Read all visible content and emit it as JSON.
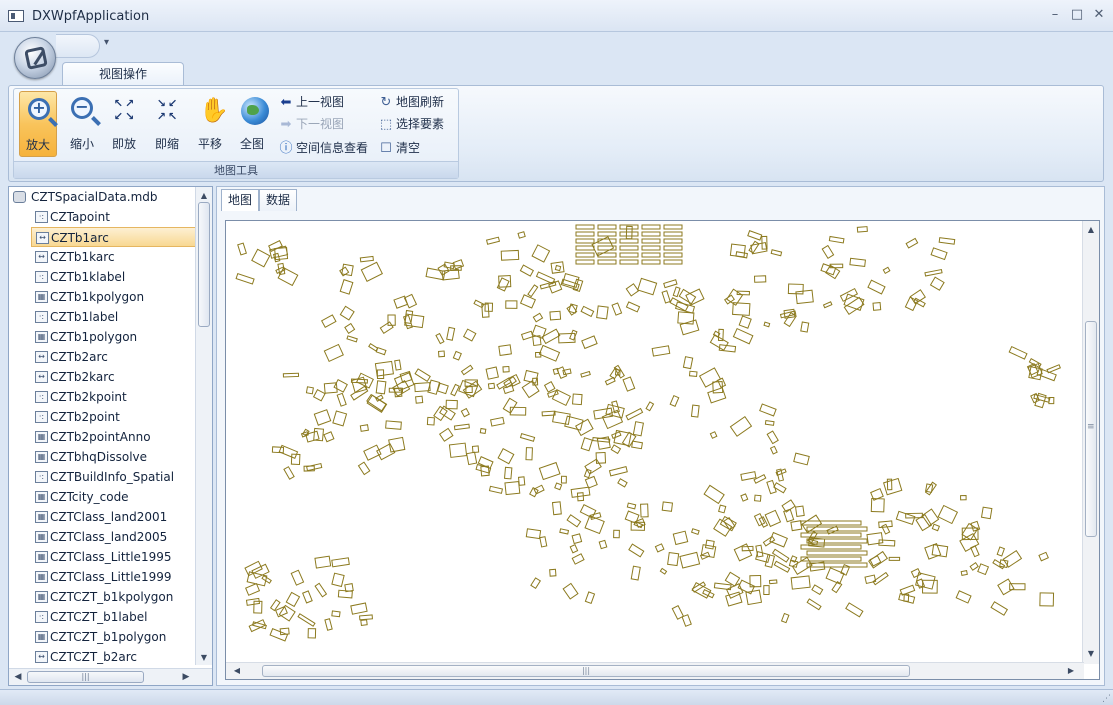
{
  "window": {
    "title": "DXWpfApplication"
  },
  "ribbon": {
    "tab": "视图操作",
    "group_caption": "地图工具",
    "big_buttons": [
      {
        "name": "zoom-in-button",
        "label": "放大",
        "icon": "zoom-in-icon",
        "active": true
      },
      {
        "name": "zoom-out-button",
        "label": "缩小",
        "icon": "zoom-out-icon"
      },
      {
        "name": "fixed-zoom-in-button",
        "label": "即放",
        "icon": "arrows-out-icon"
      },
      {
        "name": "fixed-zoom-out-button",
        "label": "即缩",
        "icon": "arrows-in-icon"
      },
      {
        "name": "pan-button",
        "label": "平移",
        "icon": "hand-icon"
      },
      {
        "name": "full-extent-button",
        "label": "全图",
        "icon": "globe-icon"
      }
    ],
    "small_buttons": {
      "prev_view": "上一视图",
      "next_view": "下一视图",
      "identify": "空间信息查看",
      "refresh": "地图刷新",
      "select": "选择要素",
      "clear": "清空"
    }
  },
  "tree": {
    "root": "CZTSpacialData.mdb",
    "items": [
      {
        "label": "CZTapoint",
        "type": "point"
      },
      {
        "label": "CZTb1arc",
        "type": "arc",
        "selected": true
      },
      {
        "label": "CZTb1karc",
        "type": "arc"
      },
      {
        "label": "CZTb1klabel",
        "type": "point"
      },
      {
        "label": "CZTb1kpolygon",
        "type": "polygon"
      },
      {
        "label": "CZTb1label",
        "type": "point"
      },
      {
        "label": "CZTb1polygon",
        "type": "polygon"
      },
      {
        "label": "CZTb2arc",
        "type": "arc"
      },
      {
        "label": "CZTb2karc",
        "type": "arc"
      },
      {
        "label": "CZTb2kpoint",
        "type": "point"
      },
      {
        "label": "CZTb2point",
        "type": "point"
      },
      {
        "label": "CZTb2pointAnno",
        "type": "polygon"
      },
      {
        "label": "CZTbhqDissolve",
        "type": "polygon"
      },
      {
        "label": "CZTBuildInfo_Spatial",
        "type": "point"
      },
      {
        "label": "CZTcity_code",
        "type": "polygon"
      },
      {
        "label": "CZTClass_land2001",
        "type": "polygon"
      },
      {
        "label": "CZTClass_land2005",
        "type": "polygon"
      },
      {
        "label": "CZTClass_Little1995",
        "type": "polygon"
      },
      {
        "label": "CZTClass_Little1999",
        "type": "polygon"
      },
      {
        "label": "CZTCZT_b1kpolygon",
        "type": "polygon"
      },
      {
        "label": "CZTCZT_b1label",
        "type": "point"
      },
      {
        "label": "CZTCZT_b1polygon",
        "type": "polygon"
      },
      {
        "label": "CZTCZT_b2arc",
        "type": "arc"
      }
    ]
  },
  "content": {
    "tabs": [
      "地图",
      "数据"
    ],
    "map_stroke": "#8c7a1f"
  },
  "colors": {
    "accent": "#f9c45c",
    "frame": "#a9bcd6"
  }
}
